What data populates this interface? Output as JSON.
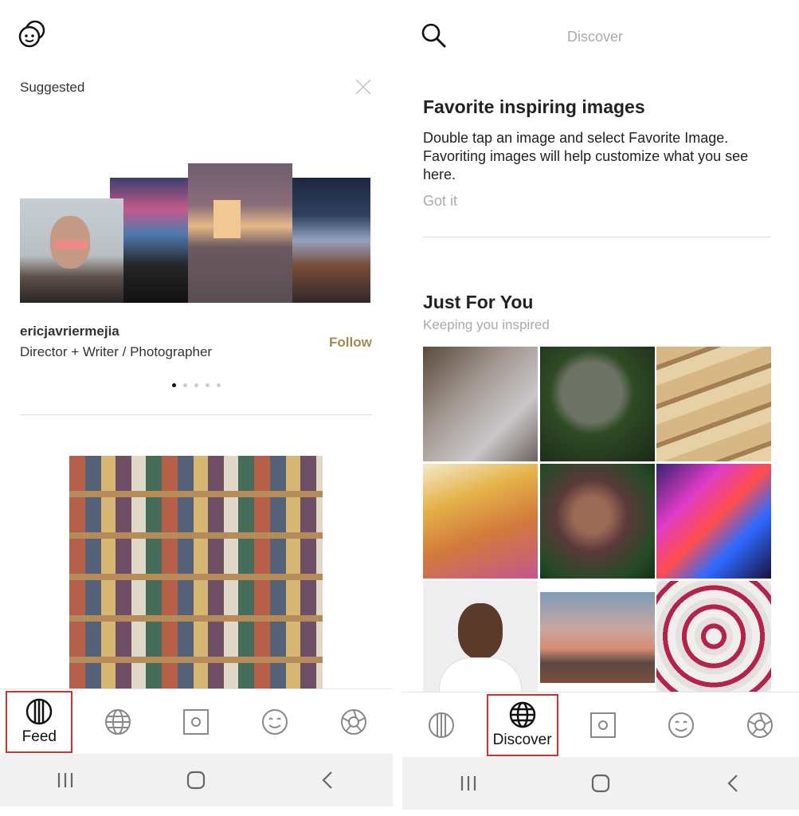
{
  "left": {
    "suggested_label": "Suggested",
    "username": "ericjavriermejia",
    "bio": "Director + Writer / Photographer",
    "follow_label": "Follow",
    "pager_count": 5,
    "tabs": [
      {
        "icon": "feed-icon",
        "label": "Feed",
        "active": true
      },
      {
        "icon": "globe-icon",
        "label": "",
        "active": false
      },
      {
        "icon": "square-dot-icon",
        "label": "",
        "active": false
      },
      {
        "icon": "smile-icon",
        "label": "",
        "active": false
      },
      {
        "icon": "aperture-icon",
        "label": "",
        "active": false
      }
    ]
  },
  "right": {
    "header_title": "Discover",
    "tip_title": "Favorite inspiring images",
    "tip_body": "Double tap an image and select Favorite Image. Favoriting images will help customize what you see here.",
    "tip_action": "Got it",
    "section_title": "Just For You",
    "section_subtitle": "Keeping you inspired",
    "tabs": [
      {
        "icon": "feed-icon",
        "label": "",
        "active": false
      },
      {
        "icon": "globe-icon",
        "label": "Discover",
        "active": true
      },
      {
        "icon": "square-dot-icon",
        "label": "",
        "active": false
      },
      {
        "icon": "smile-icon",
        "label": "",
        "active": false
      },
      {
        "icon": "aperture-icon",
        "label": "",
        "active": false
      }
    ]
  },
  "colors": {
    "follow": "#a08c50",
    "active_tab_border": "#d32f2f",
    "muted": "#999999"
  }
}
